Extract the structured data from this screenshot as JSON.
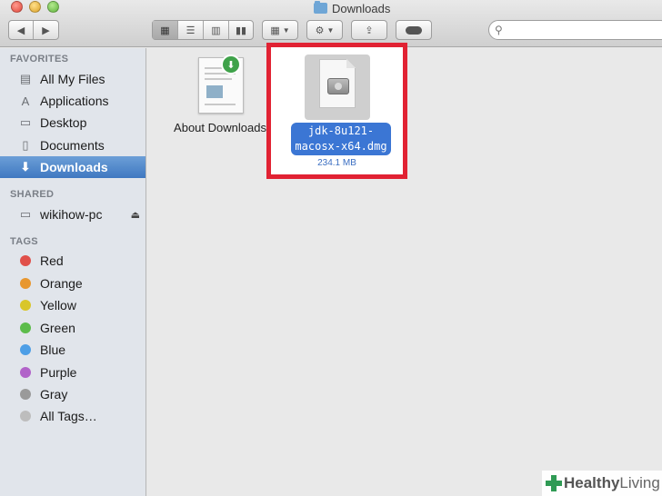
{
  "window": {
    "title": "Downloads"
  },
  "toolbar": {
    "back_icon": "chevron-left-icon",
    "forward_icon": "chevron-right-icon",
    "view_modes": [
      "icon-view",
      "list-view",
      "column-view",
      "coverflow-view"
    ],
    "active_view": "icon-view",
    "arrange_icon": "grid-icon",
    "action_icon": "gear-icon",
    "share_icon": "share-icon",
    "tag_icon": "tag-icon",
    "search_placeholder": ""
  },
  "sidebar": {
    "favorites_title": "FAVORITES",
    "favorites": [
      {
        "label": "All My Files",
        "icon": "files-icon"
      },
      {
        "label": "Applications",
        "icon": "applications-icon"
      },
      {
        "label": "Desktop",
        "icon": "desktop-icon"
      },
      {
        "label": "Documents",
        "icon": "documents-icon"
      },
      {
        "label": "Downloads",
        "icon": "downloads-icon",
        "selected": true
      }
    ],
    "shared_title": "SHARED",
    "shared": [
      {
        "label": "wikihow-pc",
        "icon": "computer-icon"
      }
    ],
    "tags_title": "TAGS",
    "tags": [
      {
        "label": "Red",
        "color": "#e0504a"
      },
      {
        "label": "Orange",
        "color": "#e8972f"
      },
      {
        "label": "Yellow",
        "color": "#d9c62a"
      },
      {
        "label": "Green",
        "color": "#5cbc4b"
      },
      {
        "label": "Blue",
        "color": "#4d9ee6"
      },
      {
        "label": "Purple",
        "color": "#b163c9"
      },
      {
        "label": "Gray",
        "color": "#9a9a9a"
      },
      {
        "label": "All Tags…",
        "color": "#bdbdbd"
      }
    ]
  },
  "files": [
    {
      "name": "About Downloads",
      "icon": "document-icon"
    },
    {
      "name_line1": "jdk-8u121-",
      "name_line2": "macosx-x64.dmg",
      "size": "234.1 MB",
      "icon": "disk-image-icon",
      "selected": true
    }
  ],
  "watermark": {
    "bold": "Healthy",
    "light": "Living"
  },
  "colors": {
    "selection": "#3b76d4",
    "highlight_border": "#e12233",
    "sidebar_bg": "#e1e5eb"
  }
}
